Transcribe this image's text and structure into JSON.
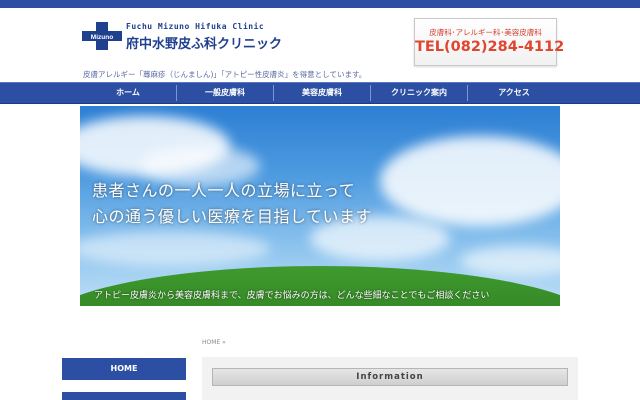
{
  "header": {
    "logo_badge": "Mizuno",
    "logo_en": "Fuchu Mizuno Hifuka Clinic",
    "logo_jp": "府中水野皮ふ科クリニック",
    "contact_sub": "皮膚科･アレルギー科･美容皮膚科",
    "contact_tel": "TEL(082)284-4112",
    "tagline": "皮膚アレルギー「蕁麻疹（じんましん)」「アトピー性皮膚炎」を得意としています。"
  },
  "nav": {
    "items": [
      {
        "label": "ホーム"
      },
      {
        "label": "一般皮膚科"
      },
      {
        "label": "美容皮膚科"
      },
      {
        "label": "クリニック案内"
      },
      {
        "label": "アクセス"
      }
    ]
  },
  "hero": {
    "line1": "患者さんの一人一人の立場に立って",
    "line2": "心の通う優しい医療を目指しています",
    "sub": "アトピー皮膚炎から美容皮膚科まで、皮膚でお悩みの方は、どんな些細なことでもご相談ください"
  },
  "breadcrumb": "HOME »",
  "sidebar": {
    "home_label": "HOME"
  },
  "main": {
    "info_heading": "Information"
  },
  "colors": {
    "brand_blue": "#2d4fa3",
    "tel_red": "#e0452f"
  }
}
